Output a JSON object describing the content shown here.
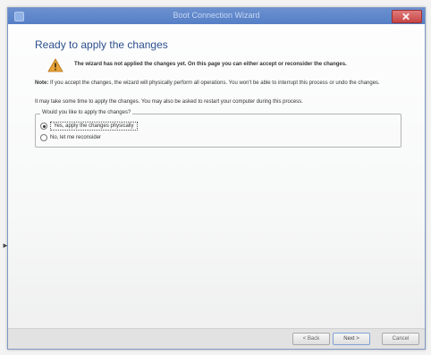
{
  "window": {
    "title": "Boot Connection Wizard"
  },
  "page": {
    "heading": "Ready to apply the changes",
    "warning": "The wizard has not applied the changes yet. On this page you can either accept or reconsider the changes.",
    "note_label": "Note:",
    "note": "If you accept the changes, the wizard will physically perform all operations. You won't be able to interrupt this process or undo the changes.",
    "time_notice": "It may take some time to apply the changes. You may also be asked to restart your computer during this process."
  },
  "apply_group": {
    "legend": "Would you like to apply the changes?",
    "options": [
      {
        "label": "Yes, apply the changes physically",
        "selected": true
      },
      {
        "label": "No, let me reconsider",
        "selected": false
      }
    ]
  },
  "buttons": {
    "back": "< Back",
    "next": "Next >",
    "cancel": "Cancel"
  },
  "icons": {
    "warning": "warning-icon",
    "app": "app-icon",
    "close": "close-icon"
  },
  "colors": {
    "title_bar": "#557fc6",
    "heading": "#2d4f8c",
    "warning": "#e8a23a"
  }
}
